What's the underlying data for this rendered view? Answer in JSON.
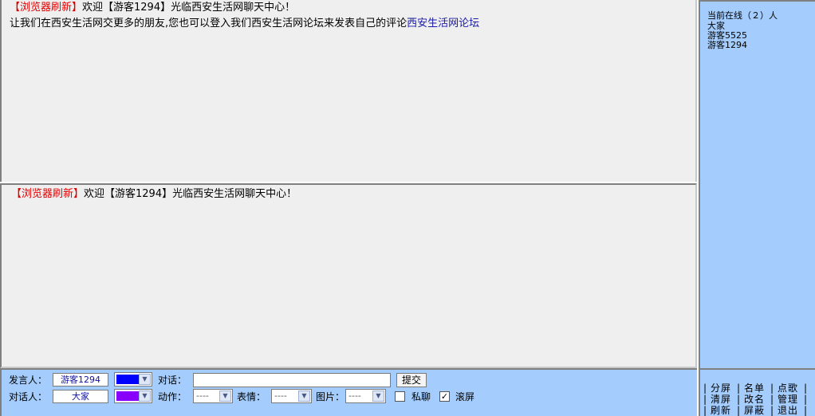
{
  "top_pane": {
    "line1": {
      "sys": "【浏览器刷新】",
      "text": "欢迎【游客1294】光临西安生活网聊天中心！"
    },
    "line2": {
      "text": "让我们在西安生活网交更多的朋友,您也可以登入我们西安生活网论坛来发表自己的评论",
      "link": "西安生活网论坛"
    }
  },
  "bottom_pane": {
    "line1": {
      "sys": "【浏览器刷新】",
      "text": "欢迎【游客1294】光临西安生活网聊天中心！"
    }
  },
  "sidebar": {
    "online_title": "当前在线（２）人",
    "users": [
      "大家",
      "游客5525",
      "游客1294"
    ]
  },
  "input_bar": {
    "speaker_label": "发言人：",
    "speaker_value": "游客1294",
    "target_label": "对话人：",
    "target_value": "大家",
    "dialog_label": "对话：",
    "message_value": "",
    "submit_label": "提交",
    "action_label": "动作：",
    "action_value": "----",
    "expression_label": "表情：",
    "expression_value": "----",
    "picture_label": "图片：",
    "picture_value": "----",
    "private_label": "私聊",
    "private_checked": false,
    "scroll_label": "滚屏",
    "scroll_checked": true,
    "speaker_color": "#0000ff",
    "target_color": "#8800ff"
  },
  "commands": {
    "col1": [
      "分屏",
      "清屏",
      "刷新"
    ],
    "col2": [
      "名单",
      "改名",
      "屏蔽"
    ],
    "col3": [
      "点歌",
      "管理",
      "退出"
    ]
  },
  "colors": {
    "pane_bg": "#efefef",
    "panel_blue": "#a4ccfc",
    "system_red": "#e00000",
    "link_blue": "#1a1aa6"
  }
}
